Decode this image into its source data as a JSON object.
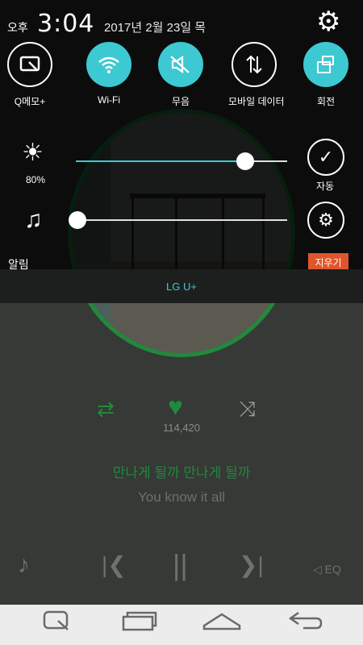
{
  "status_bar": {
    "ampm": "오후",
    "time": "3:04",
    "date": "2017년 2월 23일 목"
  },
  "quick_settings": [
    {
      "label": "Q메모+",
      "icon": "qmemo-icon",
      "active": false
    },
    {
      "label": "Wi-Fi",
      "icon": "wifi-icon",
      "active": true
    },
    {
      "label": "무음",
      "icon": "mute-icon",
      "active": true
    },
    {
      "label": "모바일 데이터",
      "icon": "mobile-data-icon",
      "active": false
    },
    {
      "label": "회전",
      "icon": "rotate-icon",
      "active": true
    }
  ],
  "brightness": {
    "value_text": "80%",
    "level": 0.8,
    "auto_label": "자동"
  },
  "sound": {
    "label": "알림",
    "level": 0.0
  },
  "clear_label": "지우기",
  "carrier": "LG U+",
  "player": {
    "likes": "114,420",
    "lyric_primary": "만나게 될까 만나게 될까",
    "lyric_secondary": "You know it all",
    "eq_label": "EQ"
  },
  "colors": {
    "accent": "#3cc9d2",
    "player_green": "#1f8a3c",
    "clear_button": "#e0562c"
  }
}
